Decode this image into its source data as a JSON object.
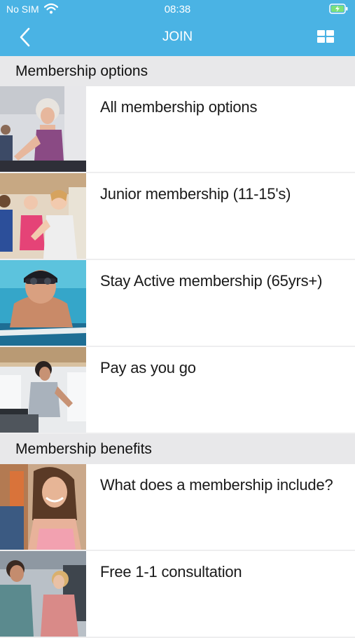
{
  "status": {
    "carrier": "No SIM",
    "time": "08:38"
  },
  "nav": {
    "title": "JOIN"
  },
  "sections": [
    {
      "title": "Membership options",
      "items": [
        {
          "label": "All membership options"
        },
        {
          "label": "Junior membership (11-15's)"
        },
        {
          "label": "Stay Active membership (65yrs+)"
        },
        {
          "label": "Pay as you go"
        }
      ]
    },
    {
      "title": "Membership benefits",
      "items": [
        {
          "label": "What does a membership include?"
        },
        {
          "label": "Free 1-1 consultation"
        }
      ]
    }
  ]
}
